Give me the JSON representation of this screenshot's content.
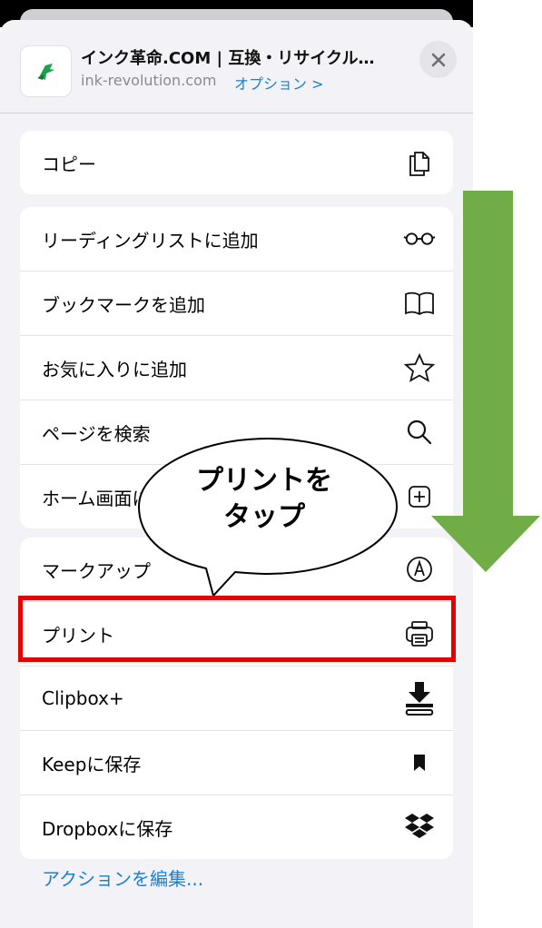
{
  "header": {
    "title": "インク革命.COM | 互換・リサイクル…",
    "domain": "ink-revolution.com",
    "options": "オプション >"
  },
  "groups": [
    {
      "items": [
        {
          "label": "コピー",
          "icon": "copy-icon"
        }
      ]
    },
    {
      "items": [
        {
          "label": "リーディングリストに追加",
          "icon": "glasses-icon"
        },
        {
          "label": "ブックマークを追加",
          "icon": "book-icon"
        },
        {
          "label": "お気に入りに追加",
          "icon": "star-icon"
        },
        {
          "label": "ページを検索",
          "icon": "search-icon"
        },
        {
          "label": "ホーム画面に追加",
          "icon": "plus-square-icon"
        }
      ]
    },
    {
      "items": [
        {
          "label": "マークアップ",
          "icon": "markup-icon"
        },
        {
          "label": "プリント",
          "icon": "printer-icon"
        },
        {
          "label": "Clipbox+",
          "icon": "download-clip-icon"
        },
        {
          "label": "Keepに保存",
          "icon": "bookmark-flag-icon"
        },
        {
          "label": "Dropboxに保存",
          "icon": "dropbox-icon"
        }
      ]
    }
  ],
  "edit_actions": "アクションを編集...",
  "callout": {
    "line1": "プリントを",
    "line2": "タップ"
  },
  "colors": {
    "accent": "#1a7fd6",
    "highlight": "#e60000",
    "arrow": "#70ad47"
  }
}
